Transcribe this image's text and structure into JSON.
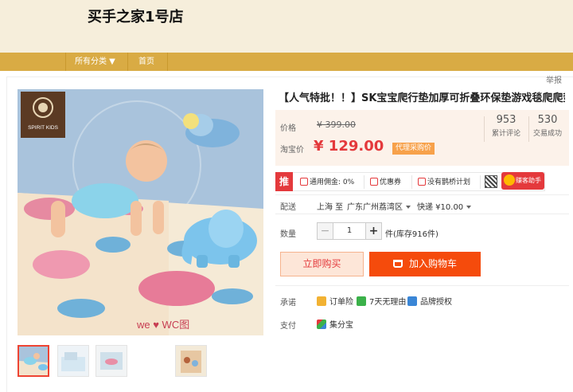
{
  "shop": {
    "name": "买手之家1号店"
  },
  "nav": {
    "all_categories": "所有分类 ▼",
    "home": "首页"
  },
  "report": "举报",
  "product": {
    "title": "【人气特批！！】SK宝宝爬行垫加厚可折叠环保垫游戏毯爬爬垫",
    "image_brand_logo": "SPIRIT KIDS",
    "image_caption": "we ♥ WC图"
  },
  "price": {
    "original_label": "价格",
    "original_value": "¥ 399.00",
    "taobao_label": "淘宝价",
    "taobao_value": "¥ 129.00",
    "purchase_badge": "代理采购价",
    "reviews_count": "953",
    "reviews_label": "累计评论",
    "sales_count": "530",
    "sales_label": "交易成功"
  },
  "promo": {
    "tui": "推",
    "commission": "通用佣金: 0%",
    "coupon": "优惠券",
    "plan": "没有鹊桥计划",
    "assistant": "赚客助手"
  },
  "shipping": {
    "label": "配送",
    "from": "上海 至",
    "to": "广东广州荔湾区",
    "method": "快递 ¥10.00"
  },
  "quantity": {
    "label": "数量",
    "minus": "−",
    "value": "1",
    "plus": "+",
    "stock": "件(库存916件)"
  },
  "buttons": {
    "buy_now": "立即购买",
    "add_to_cart": "加入购物车"
  },
  "promise": {
    "label": "承诺",
    "items": [
      "订单险",
      "7天无理由",
      "品牌授权"
    ]
  },
  "payment": {
    "label": "支付",
    "method": "集分宝"
  },
  "colors": {
    "accent": "#e4393c",
    "nav_bar": "#d9ab44",
    "header_bg": "#f6eedb",
    "cart_button": "#f54b0c"
  }
}
